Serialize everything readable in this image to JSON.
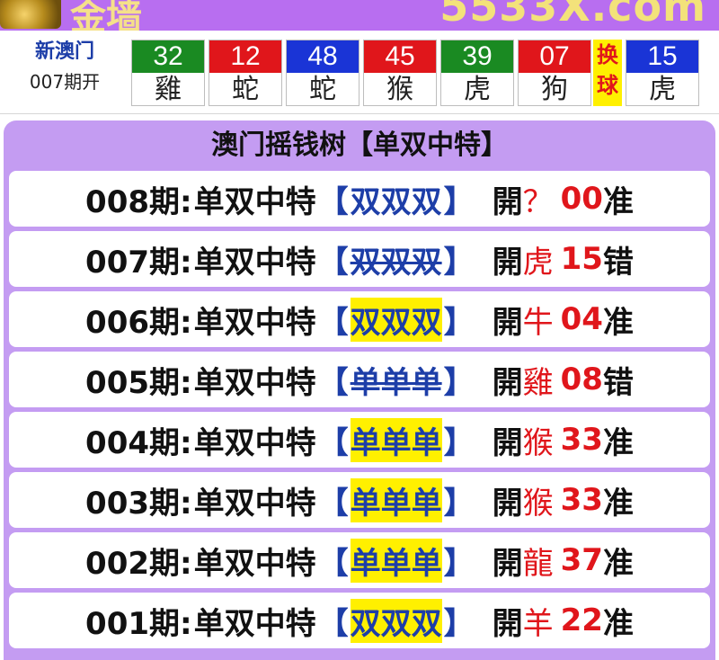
{
  "banner": {
    "brand_left": "金墙",
    "brand_right": "5533X.com"
  },
  "latest": {
    "title": "新澳门",
    "issue": "007期开",
    "balls": [
      {
        "num": "32",
        "zodiac": "雞",
        "color": "#1a8a22"
      },
      {
        "num": "12",
        "zodiac": "蛇",
        "color": "#e0161b"
      },
      {
        "num": "48",
        "zodiac": "蛇",
        "color": "#1a34d6"
      },
      {
        "num": "45",
        "zodiac": "猴",
        "color": "#e0161b"
      },
      {
        "num": "39",
        "zodiac": "虎",
        "color": "#1a8a22"
      },
      {
        "num": "07",
        "zodiac": "狗",
        "color": "#e0161b"
      }
    ],
    "swap_top": "换",
    "swap_bottom": "球",
    "special": {
      "num": "15",
      "zodiac": "虎",
      "color": "#1a34d6"
    }
  },
  "panel": {
    "title": "澳门摇钱树【单双中特】",
    "rows": [
      {
        "issue": "008期:",
        "kind": "单双中特",
        "lb": "【",
        "pick": "双双双",
        "rb": "】",
        "open": "開",
        "zodiac": "？",
        "num": "00",
        "verdict": "准",
        "style": "plain"
      },
      {
        "issue": "007期:",
        "kind": "单双中特",
        "lb": "【",
        "pick": "双双双",
        "rb": "】",
        "open": "開",
        "zodiac": "虎",
        "num": "15",
        "verdict": "错",
        "style": "strike"
      },
      {
        "issue": "006期:",
        "kind": "单双中特",
        "lb": "【",
        "pick": "双双双",
        "rb": "】",
        "open": "開",
        "zodiac": "牛",
        "num": "04",
        "verdict": "准",
        "style": "hl"
      },
      {
        "issue": "005期:",
        "kind": "单双中特",
        "lb": "【",
        "pick": "单单单",
        "rb": "】",
        "open": "開",
        "zodiac": "雞",
        "num": "08",
        "verdict": "错",
        "style": "strike"
      },
      {
        "issue": "004期:",
        "kind": "单双中特",
        "lb": "【",
        "pick": "单单单",
        "rb": "】",
        "open": "開",
        "zodiac": "猴",
        "num": "33",
        "verdict": "准",
        "style": "hl"
      },
      {
        "issue": "003期:",
        "kind": "单双中特",
        "lb": "【",
        "pick": "单单单",
        "rb": "】",
        "open": "開",
        "zodiac": "猴",
        "num": "33",
        "verdict": "准",
        "style": "hl"
      },
      {
        "issue": "002期:",
        "kind": "单双中特",
        "lb": "【",
        "pick": "单单单",
        "rb": "】",
        "open": "開",
        "zodiac": "龍",
        "num": "37",
        "verdict": "准",
        "style": "hl"
      },
      {
        "issue": "001期:",
        "kind": "单双中特",
        "lb": "【",
        "pick": "双双双",
        "rb": "】",
        "open": "開",
        "zodiac": "羊",
        "num": "22",
        "verdict": "准",
        "style": "hl"
      }
    ]
  }
}
